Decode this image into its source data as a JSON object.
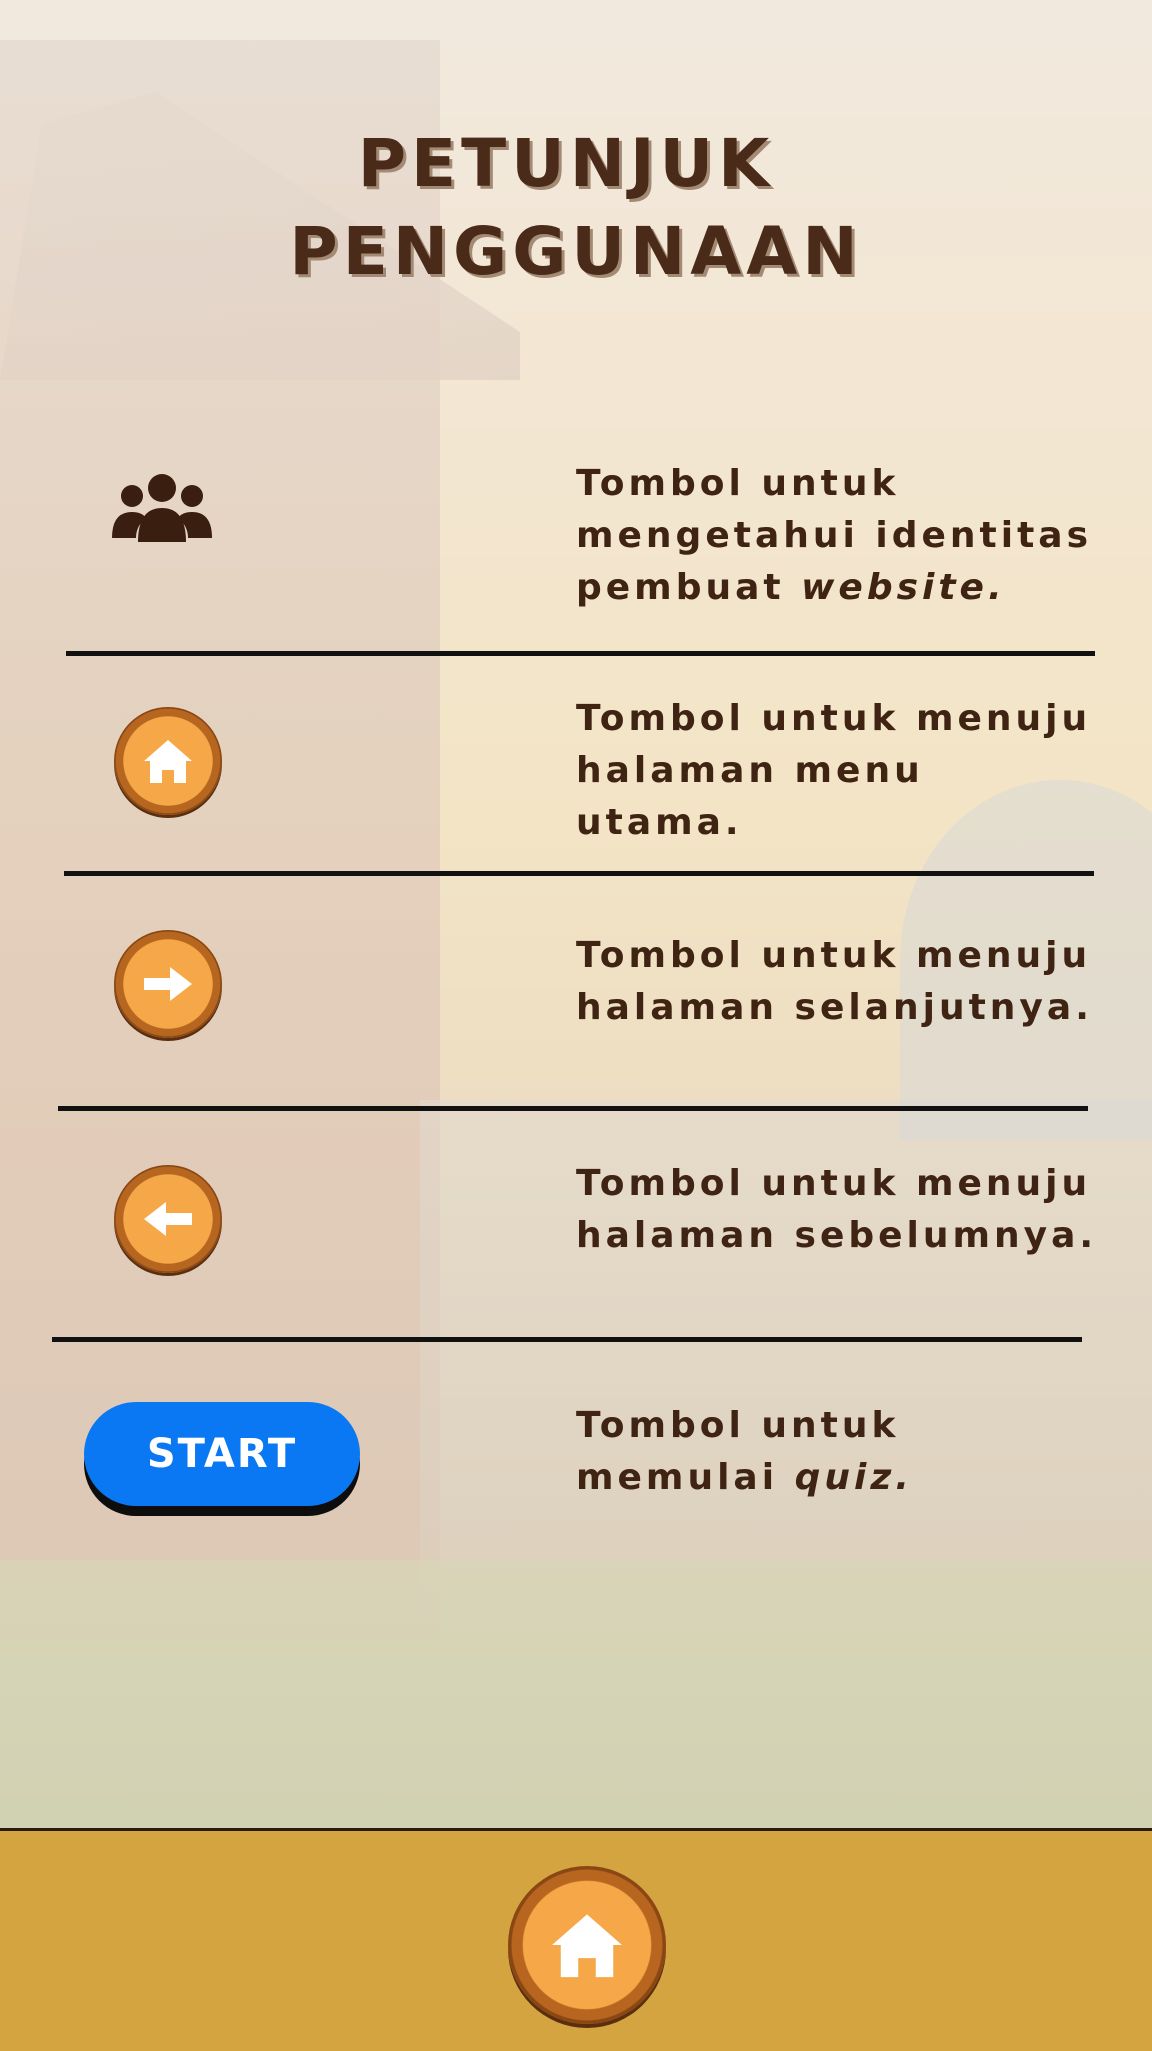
{
  "page": {
    "title_line1": "PETUNJUK",
    "title_line2": "PENGGUNAAN"
  },
  "instructions": [
    {
      "icon": "people-icon",
      "text_pre": "Tombol untuk mengetahui identitas pembuat ",
      "text_italic": "website.",
      "text_post": ""
    },
    {
      "icon": "home-button-icon",
      "text_pre": "Tombol untuk menuju halaman menu utama.",
      "text_italic": "",
      "text_post": ""
    },
    {
      "icon": "arrow-right-icon",
      "text_pre": "Tombol untuk menuju halaman selanjutnya.",
      "text_italic": "",
      "text_post": ""
    },
    {
      "icon": "arrow-left-icon",
      "text_pre": "Tombol untuk menuju halaman sebelumnya.",
      "text_italic": "",
      "text_post": ""
    },
    {
      "icon": "start-button",
      "button_label": "START",
      "text_pre": "Tombol untuk memulai ",
      "text_italic": "quiz.",
      "text_post": ""
    }
  ],
  "footer": {
    "icon": "home-icon"
  },
  "colors": {
    "title": "#4a2a18",
    "text": "#3f2414",
    "button_orange": "#f39a3c",
    "start_blue": "#0a78f2",
    "footer_bg": "#d4a441"
  }
}
